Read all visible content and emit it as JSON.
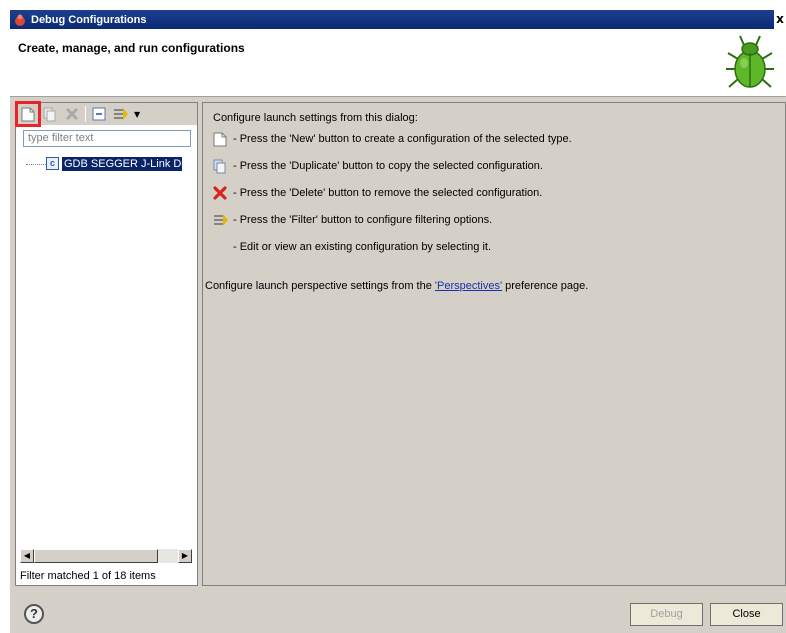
{
  "window": {
    "title": "Debug Configurations",
    "close_label": "x"
  },
  "header": {
    "heading": "Create, manage, and run configurations"
  },
  "left": {
    "filter_placeholder": "type filter text",
    "tree_items": [
      {
        "label": "GDB SEGGER J-Link Debugg",
        "icon_text": "c"
      }
    ],
    "status": "Filter matched 1 of 18 items"
  },
  "right": {
    "intro": "Configure launch settings from this dialog:",
    "rows": [
      {
        "icon": "new-config-icon",
        "text": "- Press the 'New' button to create a configuration of the selected type."
      },
      {
        "icon": "duplicate-icon",
        "text": "- Press the 'Duplicate' button to copy the selected configuration."
      },
      {
        "icon": "delete-icon",
        "text": "- Press the 'Delete' button to remove the selected configuration."
      },
      {
        "icon": "filter-icon",
        "text": "- Press the 'Filter' button to configure filtering options."
      },
      {
        "icon": "",
        "text": "- Edit or view an existing configuration by selecting it."
      }
    ],
    "perspective_prefix": "Configure launch perspective settings from the ",
    "perspective_link": "'Perspectives'",
    "perspective_suffix": " preference page."
  },
  "footer": {
    "help_label": "?",
    "debug_label": "Debug",
    "close_label": "Close"
  },
  "colors": {
    "title_bar": "#0b2a74",
    "selection": "#0a246a",
    "highlight": "#e8242b"
  }
}
